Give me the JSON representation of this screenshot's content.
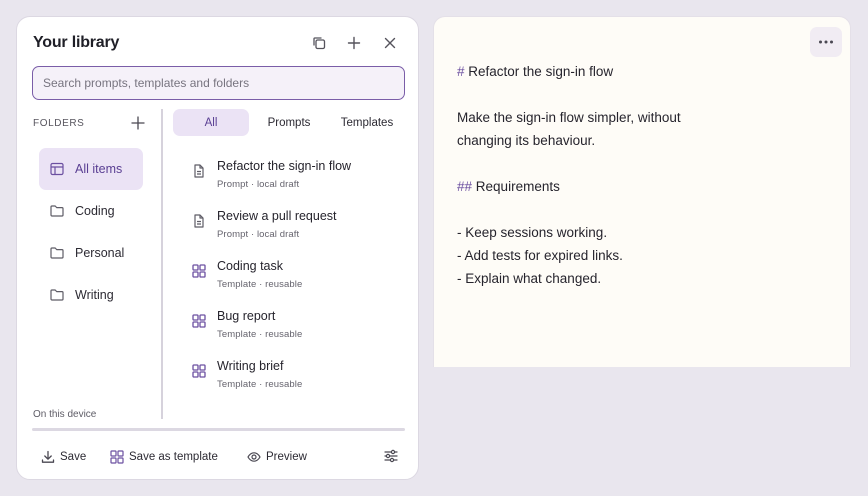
{
  "library": {
    "title": "Your library",
    "search_placeholder": "Search prompts, templates and folders",
    "folders_label": "FOLDERS",
    "folders": [
      {
        "label": "All items",
        "icon": "all-items-icon",
        "active": true
      },
      {
        "label": "Coding",
        "icon": "folder-icon"
      },
      {
        "label": "Personal",
        "icon": "folder-icon"
      },
      {
        "label": "Writing",
        "icon": "folder-icon"
      }
    ],
    "device_note": "On this device",
    "tabs": [
      {
        "label": "All",
        "active": true
      },
      {
        "label": "Prompts"
      },
      {
        "label": "Templates"
      }
    ],
    "items": [
      {
        "title": "Refactor the sign-in flow",
        "meta": "Prompt · local draft",
        "icon": "document-icon"
      },
      {
        "title": "Review a pull request",
        "meta": "Prompt · local draft",
        "icon": "document-icon"
      },
      {
        "title": "Coding task",
        "meta": "Template · reusable",
        "icon": "template-icon"
      },
      {
        "title": "Bug report",
        "meta": "Template · reusable",
        "icon": "template-icon"
      },
      {
        "title": "Writing brief",
        "meta": "Template · reusable",
        "icon": "template-icon"
      }
    ],
    "footer": {
      "save_label": "Save",
      "save_template_label": "Save as template",
      "preview_label": "Preview"
    }
  },
  "editor": {
    "lines": [
      {
        "mark": "#",
        "text": "Refactor the sign-in flow"
      },
      {
        "text": "Make the sign-in flow simpler, without"
      },
      {
        "text": "changing its behaviour."
      },
      {
        "mark": "##",
        "text": "Requirements"
      },
      {
        "text": "- Keep sessions working."
      },
      {
        "text": "- Add tests for expired links."
      },
      {
        "text": "- Explain what changed."
      }
    ]
  },
  "colors": {
    "accent": "#6b4fa0",
    "accent_soft": "#ebe3f5",
    "page_background": "#e9e6ee",
    "editor_background": "#fefcf7"
  }
}
